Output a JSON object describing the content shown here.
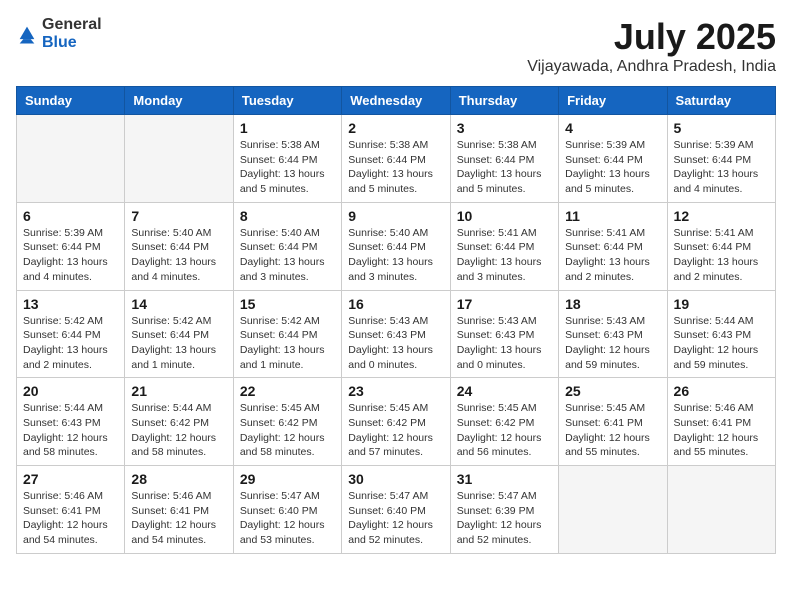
{
  "header": {
    "logo_general": "General",
    "logo_blue": "Blue",
    "month_title": "July 2025",
    "location": "Vijayawada, Andhra Pradesh, India"
  },
  "columns": [
    "Sunday",
    "Monday",
    "Tuesday",
    "Wednesday",
    "Thursday",
    "Friday",
    "Saturday"
  ],
  "weeks": [
    [
      {
        "day": "",
        "info": ""
      },
      {
        "day": "",
        "info": ""
      },
      {
        "day": "1",
        "info": "Sunrise: 5:38 AM\nSunset: 6:44 PM\nDaylight: 13 hours and 5 minutes."
      },
      {
        "day": "2",
        "info": "Sunrise: 5:38 AM\nSunset: 6:44 PM\nDaylight: 13 hours and 5 minutes."
      },
      {
        "day": "3",
        "info": "Sunrise: 5:38 AM\nSunset: 6:44 PM\nDaylight: 13 hours and 5 minutes."
      },
      {
        "day": "4",
        "info": "Sunrise: 5:39 AM\nSunset: 6:44 PM\nDaylight: 13 hours and 5 minutes."
      },
      {
        "day": "5",
        "info": "Sunrise: 5:39 AM\nSunset: 6:44 PM\nDaylight: 13 hours and 4 minutes."
      }
    ],
    [
      {
        "day": "6",
        "info": "Sunrise: 5:39 AM\nSunset: 6:44 PM\nDaylight: 13 hours and 4 minutes."
      },
      {
        "day": "7",
        "info": "Sunrise: 5:40 AM\nSunset: 6:44 PM\nDaylight: 13 hours and 4 minutes."
      },
      {
        "day": "8",
        "info": "Sunrise: 5:40 AM\nSunset: 6:44 PM\nDaylight: 13 hours and 3 minutes."
      },
      {
        "day": "9",
        "info": "Sunrise: 5:40 AM\nSunset: 6:44 PM\nDaylight: 13 hours and 3 minutes."
      },
      {
        "day": "10",
        "info": "Sunrise: 5:41 AM\nSunset: 6:44 PM\nDaylight: 13 hours and 3 minutes."
      },
      {
        "day": "11",
        "info": "Sunrise: 5:41 AM\nSunset: 6:44 PM\nDaylight: 13 hours and 2 minutes."
      },
      {
        "day": "12",
        "info": "Sunrise: 5:41 AM\nSunset: 6:44 PM\nDaylight: 13 hours and 2 minutes."
      }
    ],
    [
      {
        "day": "13",
        "info": "Sunrise: 5:42 AM\nSunset: 6:44 PM\nDaylight: 13 hours and 2 minutes."
      },
      {
        "day": "14",
        "info": "Sunrise: 5:42 AM\nSunset: 6:44 PM\nDaylight: 13 hours and 1 minute."
      },
      {
        "day": "15",
        "info": "Sunrise: 5:42 AM\nSunset: 6:44 PM\nDaylight: 13 hours and 1 minute."
      },
      {
        "day": "16",
        "info": "Sunrise: 5:43 AM\nSunset: 6:43 PM\nDaylight: 13 hours and 0 minutes."
      },
      {
        "day": "17",
        "info": "Sunrise: 5:43 AM\nSunset: 6:43 PM\nDaylight: 13 hours and 0 minutes."
      },
      {
        "day": "18",
        "info": "Sunrise: 5:43 AM\nSunset: 6:43 PM\nDaylight: 12 hours and 59 minutes."
      },
      {
        "day": "19",
        "info": "Sunrise: 5:44 AM\nSunset: 6:43 PM\nDaylight: 12 hours and 59 minutes."
      }
    ],
    [
      {
        "day": "20",
        "info": "Sunrise: 5:44 AM\nSunset: 6:43 PM\nDaylight: 12 hours and 58 minutes."
      },
      {
        "day": "21",
        "info": "Sunrise: 5:44 AM\nSunset: 6:42 PM\nDaylight: 12 hours and 58 minutes."
      },
      {
        "day": "22",
        "info": "Sunrise: 5:45 AM\nSunset: 6:42 PM\nDaylight: 12 hours and 58 minutes."
      },
      {
        "day": "23",
        "info": "Sunrise: 5:45 AM\nSunset: 6:42 PM\nDaylight: 12 hours and 57 minutes."
      },
      {
        "day": "24",
        "info": "Sunrise: 5:45 AM\nSunset: 6:42 PM\nDaylight: 12 hours and 56 minutes."
      },
      {
        "day": "25",
        "info": "Sunrise: 5:45 AM\nSunset: 6:41 PM\nDaylight: 12 hours and 55 minutes."
      },
      {
        "day": "26",
        "info": "Sunrise: 5:46 AM\nSunset: 6:41 PM\nDaylight: 12 hours and 55 minutes."
      }
    ],
    [
      {
        "day": "27",
        "info": "Sunrise: 5:46 AM\nSunset: 6:41 PM\nDaylight: 12 hours and 54 minutes."
      },
      {
        "day": "28",
        "info": "Sunrise: 5:46 AM\nSunset: 6:41 PM\nDaylight: 12 hours and 54 minutes."
      },
      {
        "day": "29",
        "info": "Sunrise: 5:47 AM\nSunset: 6:40 PM\nDaylight: 12 hours and 53 minutes."
      },
      {
        "day": "30",
        "info": "Sunrise: 5:47 AM\nSunset: 6:40 PM\nDaylight: 12 hours and 52 minutes."
      },
      {
        "day": "31",
        "info": "Sunrise: 5:47 AM\nSunset: 6:39 PM\nDaylight: 12 hours and 52 minutes."
      },
      {
        "day": "",
        "info": ""
      },
      {
        "day": "",
        "info": ""
      }
    ]
  ]
}
